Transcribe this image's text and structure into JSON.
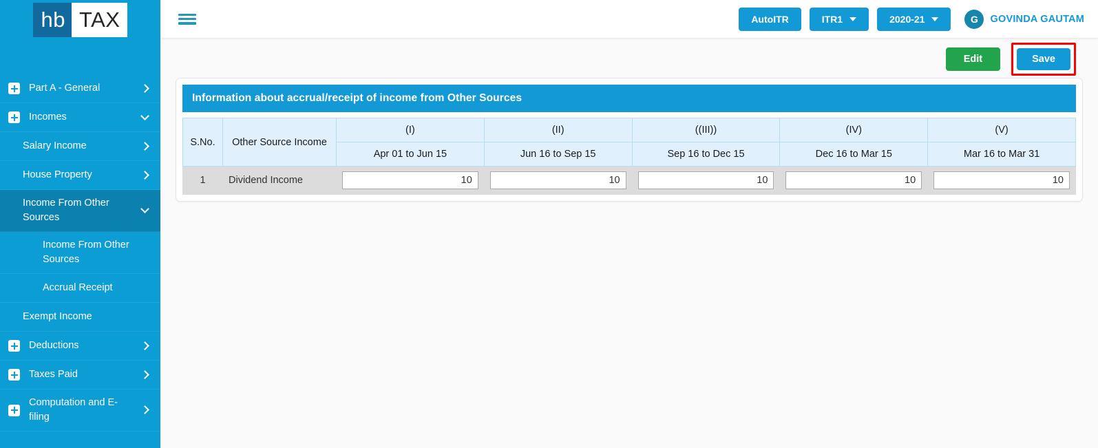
{
  "brand": {
    "logo_primary": "hb",
    "logo_secondary": "TAX",
    "accent_blue": "#139ad6",
    "sidebar_blue": "#0b9dd4",
    "sidebar_active_blue": "#0a81ae",
    "edit_green": "#22a44c",
    "highlight_red": "#ff0000"
  },
  "topbar": {
    "menu_icon": "hamburger-menu-icon",
    "autoitr_label": "AutoITR",
    "form_type": "ITR1",
    "assessment_year": "2020-21",
    "avatar_initial": "G",
    "user_name": "GOVINDA GAUTAM"
  },
  "actions": {
    "edit_label": "Edit",
    "save_label": "Save"
  },
  "sidebar": {
    "items": [
      {
        "label": "Part A - General",
        "icon": "plus-box-icon",
        "chevron": "right",
        "level": 0,
        "active": false
      },
      {
        "label": "Incomes",
        "icon": "plus-box-icon",
        "chevron": "down",
        "level": 0,
        "active": false
      },
      {
        "label": "Salary Income",
        "icon": null,
        "chevron": "right",
        "level": 1,
        "active": false
      },
      {
        "label": "House Property",
        "icon": null,
        "chevron": "right",
        "level": 1,
        "active": false
      },
      {
        "label": "Income From Other Sources",
        "icon": null,
        "chevron": "down",
        "level": 1,
        "active": true
      },
      {
        "label": "Income From Other Sources",
        "icon": null,
        "chevron": null,
        "level": 2,
        "active": false
      },
      {
        "label": "Accrual Receipt",
        "icon": null,
        "chevron": null,
        "level": 2,
        "active": false
      },
      {
        "label": "Exempt Income",
        "icon": null,
        "chevron": null,
        "level": 1,
        "active": false
      },
      {
        "label": "Deductions",
        "icon": "plus-box-icon",
        "chevron": "right",
        "level": 0,
        "active": false
      },
      {
        "label": "Taxes Paid",
        "icon": "plus-box-icon",
        "chevron": "right",
        "level": 0,
        "active": false
      },
      {
        "label": "Computation and E-filing",
        "icon": "plus-box-icon",
        "chevron": "right",
        "level": 0,
        "active": false
      }
    ]
  },
  "panel": {
    "title": "Information about accrual/receipt of income from Other Sources",
    "table": {
      "col_sno": "S.No.",
      "col_source": "Other Source Income",
      "period_numerals": [
        "(I)",
        "(II)",
        "((III))",
        "(IV)",
        "(V)"
      ],
      "period_ranges": [
        "Apr 01 to Jun 15",
        "Jun 16 to Sep 15",
        "Sep 16 to Dec 15",
        "Dec 16 to Mar 15",
        "Mar 16 to Mar 31"
      ],
      "rows": [
        {
          "sno": "1",
          "source": "Dividend Income",
          "values": [
            "10",
            "10",
            "10",
            "10",
            "10"
          ]
        }
      ]
    }
  }
}
